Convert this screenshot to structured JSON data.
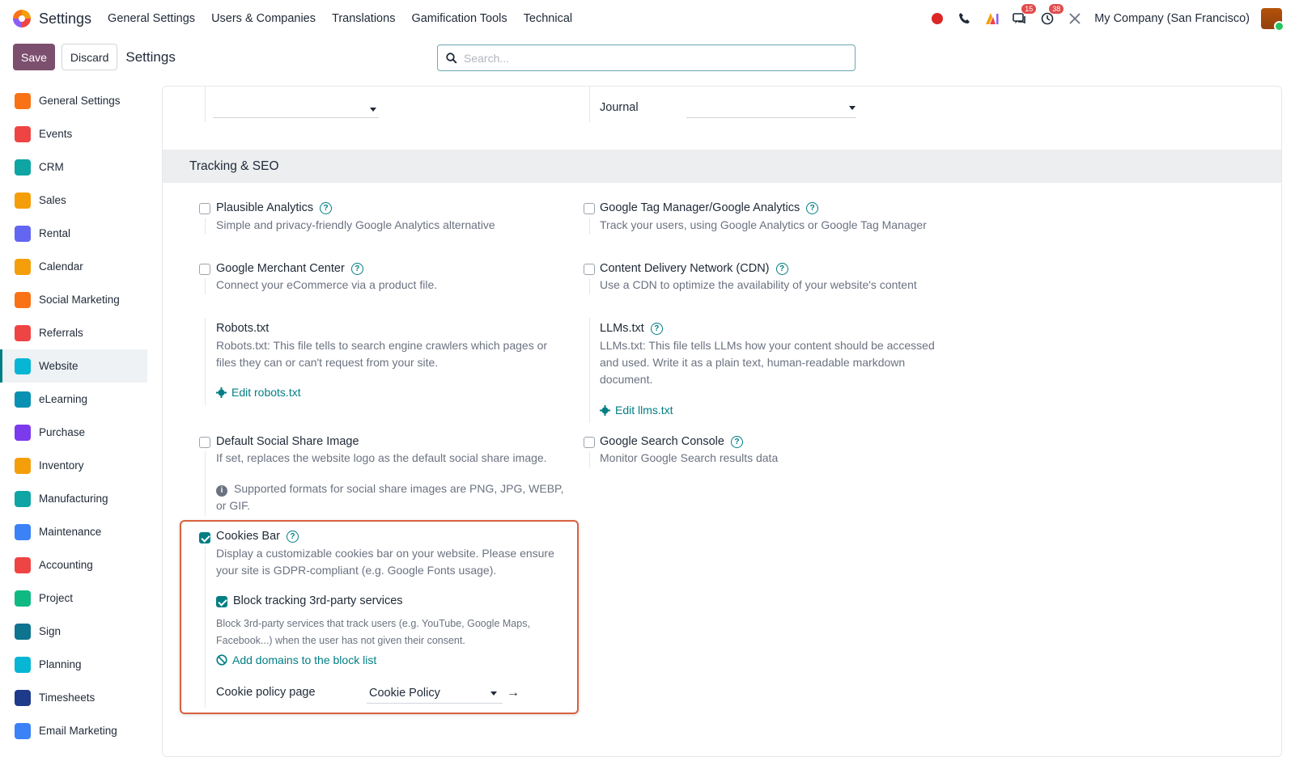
{
  "topbar": {
    "app_title": "Settings",
    "menu": [
      "General Settings",
      "Users & Companies",
      "Translations",
      "Gamification Tools",
      "Technical"
    ],
    "badge_messages": "15",
    "badge_activities": "38",
    "company": "My Company (San Francisco)"
  },
  "controlbar": {
    "save_label": "Save",
    "discard_label": "Discard",
    "title": "Settings",
    "search_placeholder": "Search..."
  },
  "sidebar": {
    "items": [
      {
        "label": "General Settings",
        "color": "#f97316"
      },
      {
        "label": "Events",
        "color": "#ef4444"
      },
      {
        "label": "CRM",
        "color": "#0ea5a4"
      },
      {
        "label": "Sales",
        "color": "#f59e0b"
      },
      {
        "label": "Rental",
        "color": "#6366f1"
      },
      {
        "label": "Calendar",
        "color": "#f59e0b"
      },
      {
        "label": "Social Marketing",
        "color": "#f97316"
      },
      {
        "label": "Referrals",
        "color": "#ef4444"
      },
      {
        "label": "Website",
        "color": "#06b6d4"
      },
      {
        "label": "eLearning",
        "color": "#0891b2"
      },
      {
        "label": "Purchase",
        "color": "#7c3aed"
      },
      {
        "label": "Inventory",
        "color": "#f59e0b"
      },
      {
        "label": "Manufacturing",
        "color": "#0ea5a4"
      },
      {
        "label": "Maintenance",
        "color": "#3b82f6"
      },
      {
        "label": "Accounting",
        "color": "#ef4444"
      },
      {
        "label": "Project",
        "color": "#10b981"
      },
      {
        "label": "Sign",
        "color": "#0e7490"
      },
      {
        "label": "Planning",
        "color": "#06b6d4"
      },
      {
        "label": "Timesheets",
        "color": "#1e3a8a"
      },
      {
        "label": "Email Marketing",
        "color": "#3b82f6"
      }
    ],
    "active_index": 8
  },
  "main": {
    "journal_label": "Journal",
    "section_title": "Tracking & SEO",
    "plausible": {
      "label": "Plausible Analytics",
      "desc": "Simple and privacy-friendly Google Analytics alternative"
    },
    "gtm": {
      "label": "Google Tag Manager/Google Analytics",
      "desc": "Track your users, using Google Analytics or Google Tag Manager"
    },
    "merchant": {
      "label": "Google Merchant Center",
      "desc": "Connect your eCommerce via a product file."
    },
    "cdn": {
      "label": "Content Delivery Network (CDN)",
      "desc": "Use a CDN to optimize the availability of your website's content"
    },
    "robots": {
      "label": "Robots.txt",
      "desc": "Robots.txt: This file tells to search engine crawlers which pages or files they can or can't request from your site.",
      "link": "Edit robots.txt"
    },
    "llms": {
      "label": "LLMs.txt",
      "desc": "LLMs.txt: This file tells LLMs how your content should be accessed and used. Write it as a plain text, human-readable markdown document.",
      "link": "Edit llms.txt"
    },
    "share_image": {
      "label": "Default Social Share Image",
      "desc": "If set, replaces the website logo as the default social share image.",
      "note": "Supported formats for social share images are PNG, JPG, WEBP, or GIF."
    },
    "search_console": {
      "label": "Google Search Console",
      "desc": "Monitor Google Search results data"
    },
    "cookies": {
      "label": "Cookies Bar",
      "desc": "Display a customizable cookies bar on your website. Please ensure your site is GDPR-compliant (e.g. Google Fonts usage).",
      "block_label": "Block tracking 3rd-party services",
      "block_desc": "Block 3rd-party services that track users (e.g. YouTube, Google Maps, Facebook...) when the user has not given their consent.",
      "add_domains": "Add domains to the block list",
      "policy_label": "Cookie policy page",
      "policy_value": "Cookie Policy"
    }
  }
}
